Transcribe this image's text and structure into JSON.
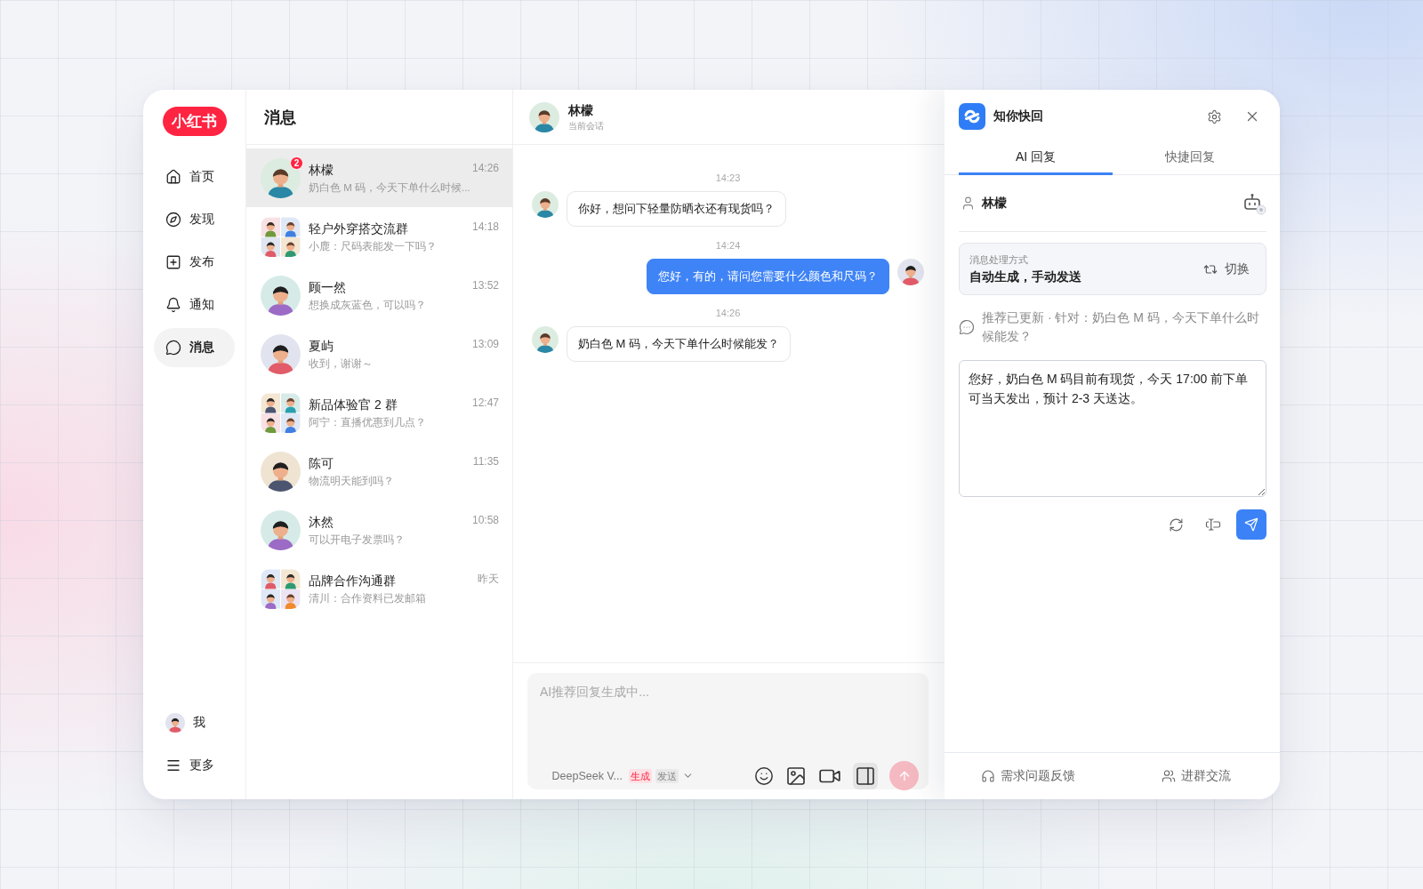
{
  "sidebar": {
    "logo": "小红书",
    "items": [
      {
        "label": "首页",
        "selected": false
      },
      {
        "label": "发现",
        "selected": false
      },
      {
        "label": "发布",
        "selected": false
      },
      {
        "label": "通知",
        "selected": false
      },
      {
        "label": "消息",
        "selected": true
      }
    ],
    "bottom_items": [
      {
        "kind": "profile",
        "label": "我"
      },
      {
        "kind": "menu",
        "label": "更多"
      }
    ]
  },
  "conversation_list": {
    "title": "消息",
    "conversations": [
      {
        "kind": "person",
        "name": "林檬",
        "preview": "奶白色 M 码，今天下单什么时候...",
        "time": "14:26",
        "unread": "2",
        "selected": true
      },
      {
        "kind": "group",
        "name": "轻户外穿搭交流群",
        "preview": "小鹿：尺码表能发一下吗？",
        "time": "14:18",
        "selected": false
      },
      {
        "kind": "person",
        "name": "顾一然",
        "preview": "想换成灰蓝色，可以吗？",
        "time": "13:52",
        "selected": false
      },
      {
        "kind": "person",
        "name": "夏屿",
        "preview": "收到，谢谢～",
        "time": "13:09",
        "selected": false
      },
      {
        "kind": "group",
        "name": "新品体验官 2 群",
        "preview": "阿宁：直播优惠到几点？",
        "time": "12:47",
        "selected": false
      },
      {
        "kind": "person",
        "name": "陈可",
        "preview": "物流明天能到吗？",
        "time": "11:35",
        "selected": false
      },
      {
        "kind": "person",
        "name": "沐然",
        "preview": "可以开电子发票吗？",
        "time": "10:58",
        "selected": false
      },
      {
        "kind": "group",
        "name": "品牌合作沟通群",
        "preview": "清川：合作资料已发邮箱",
        "time": "昨天",
        "selected": false
      }
    ]
  },
  "chat": {
    "contact": "林檬",
    "subtitle": "当前会话",
    "messages": [
      {
        "time": "14:23",
        "kind": "received",
        "text": "你好，想问下轻量防晒衣还有现货吗？"
      },
      {
        "time": "14:24",
        "kind": "sent",
        "text": "您好，有的，请问您需要什么颜色和尺码？"
      },
      {
        "time": "14:26",
        "kind": "received",
        "text": "奶白色 M 码，今天下单什么时候能发？"
      }
    ],
    "composer": {
      "placeholder": "AI推荐回复生成中...",
      "model": "DeepSeek V...",
      "modes": [
        {
          "label": "生成",
          "on": true
        },
        {
          "label": "发送",
          "on": false
        }
      ],
      "panel_toggle_on": true,
      "send_disabled": true
    }
  },
  "assistant": {
    "title": "知你快回",
    "tabs": [
      {
        "label": "AI 回复",
        "selected": true
      },
      {
        "label": "快捷回复",
        "selected": false
      }
    ],
    "contact": "林檬",
    "mode": {
      "label": "消息处理方式",
      "value": "自动生成，手动发送",
      "switch_label": "切换"
    },
    "note": "推荐已更新 · 针对：奶白色 M 码，今天下单什么时候能发？",
    "draft": "您好，奶白色 M 码目前有现货，今天 17:00 前下单可当天发出，预计 2-3 天送达。",
    "footer_links": [
      "需求问题反馈",
      "进群交流"
    ]
  }
}
